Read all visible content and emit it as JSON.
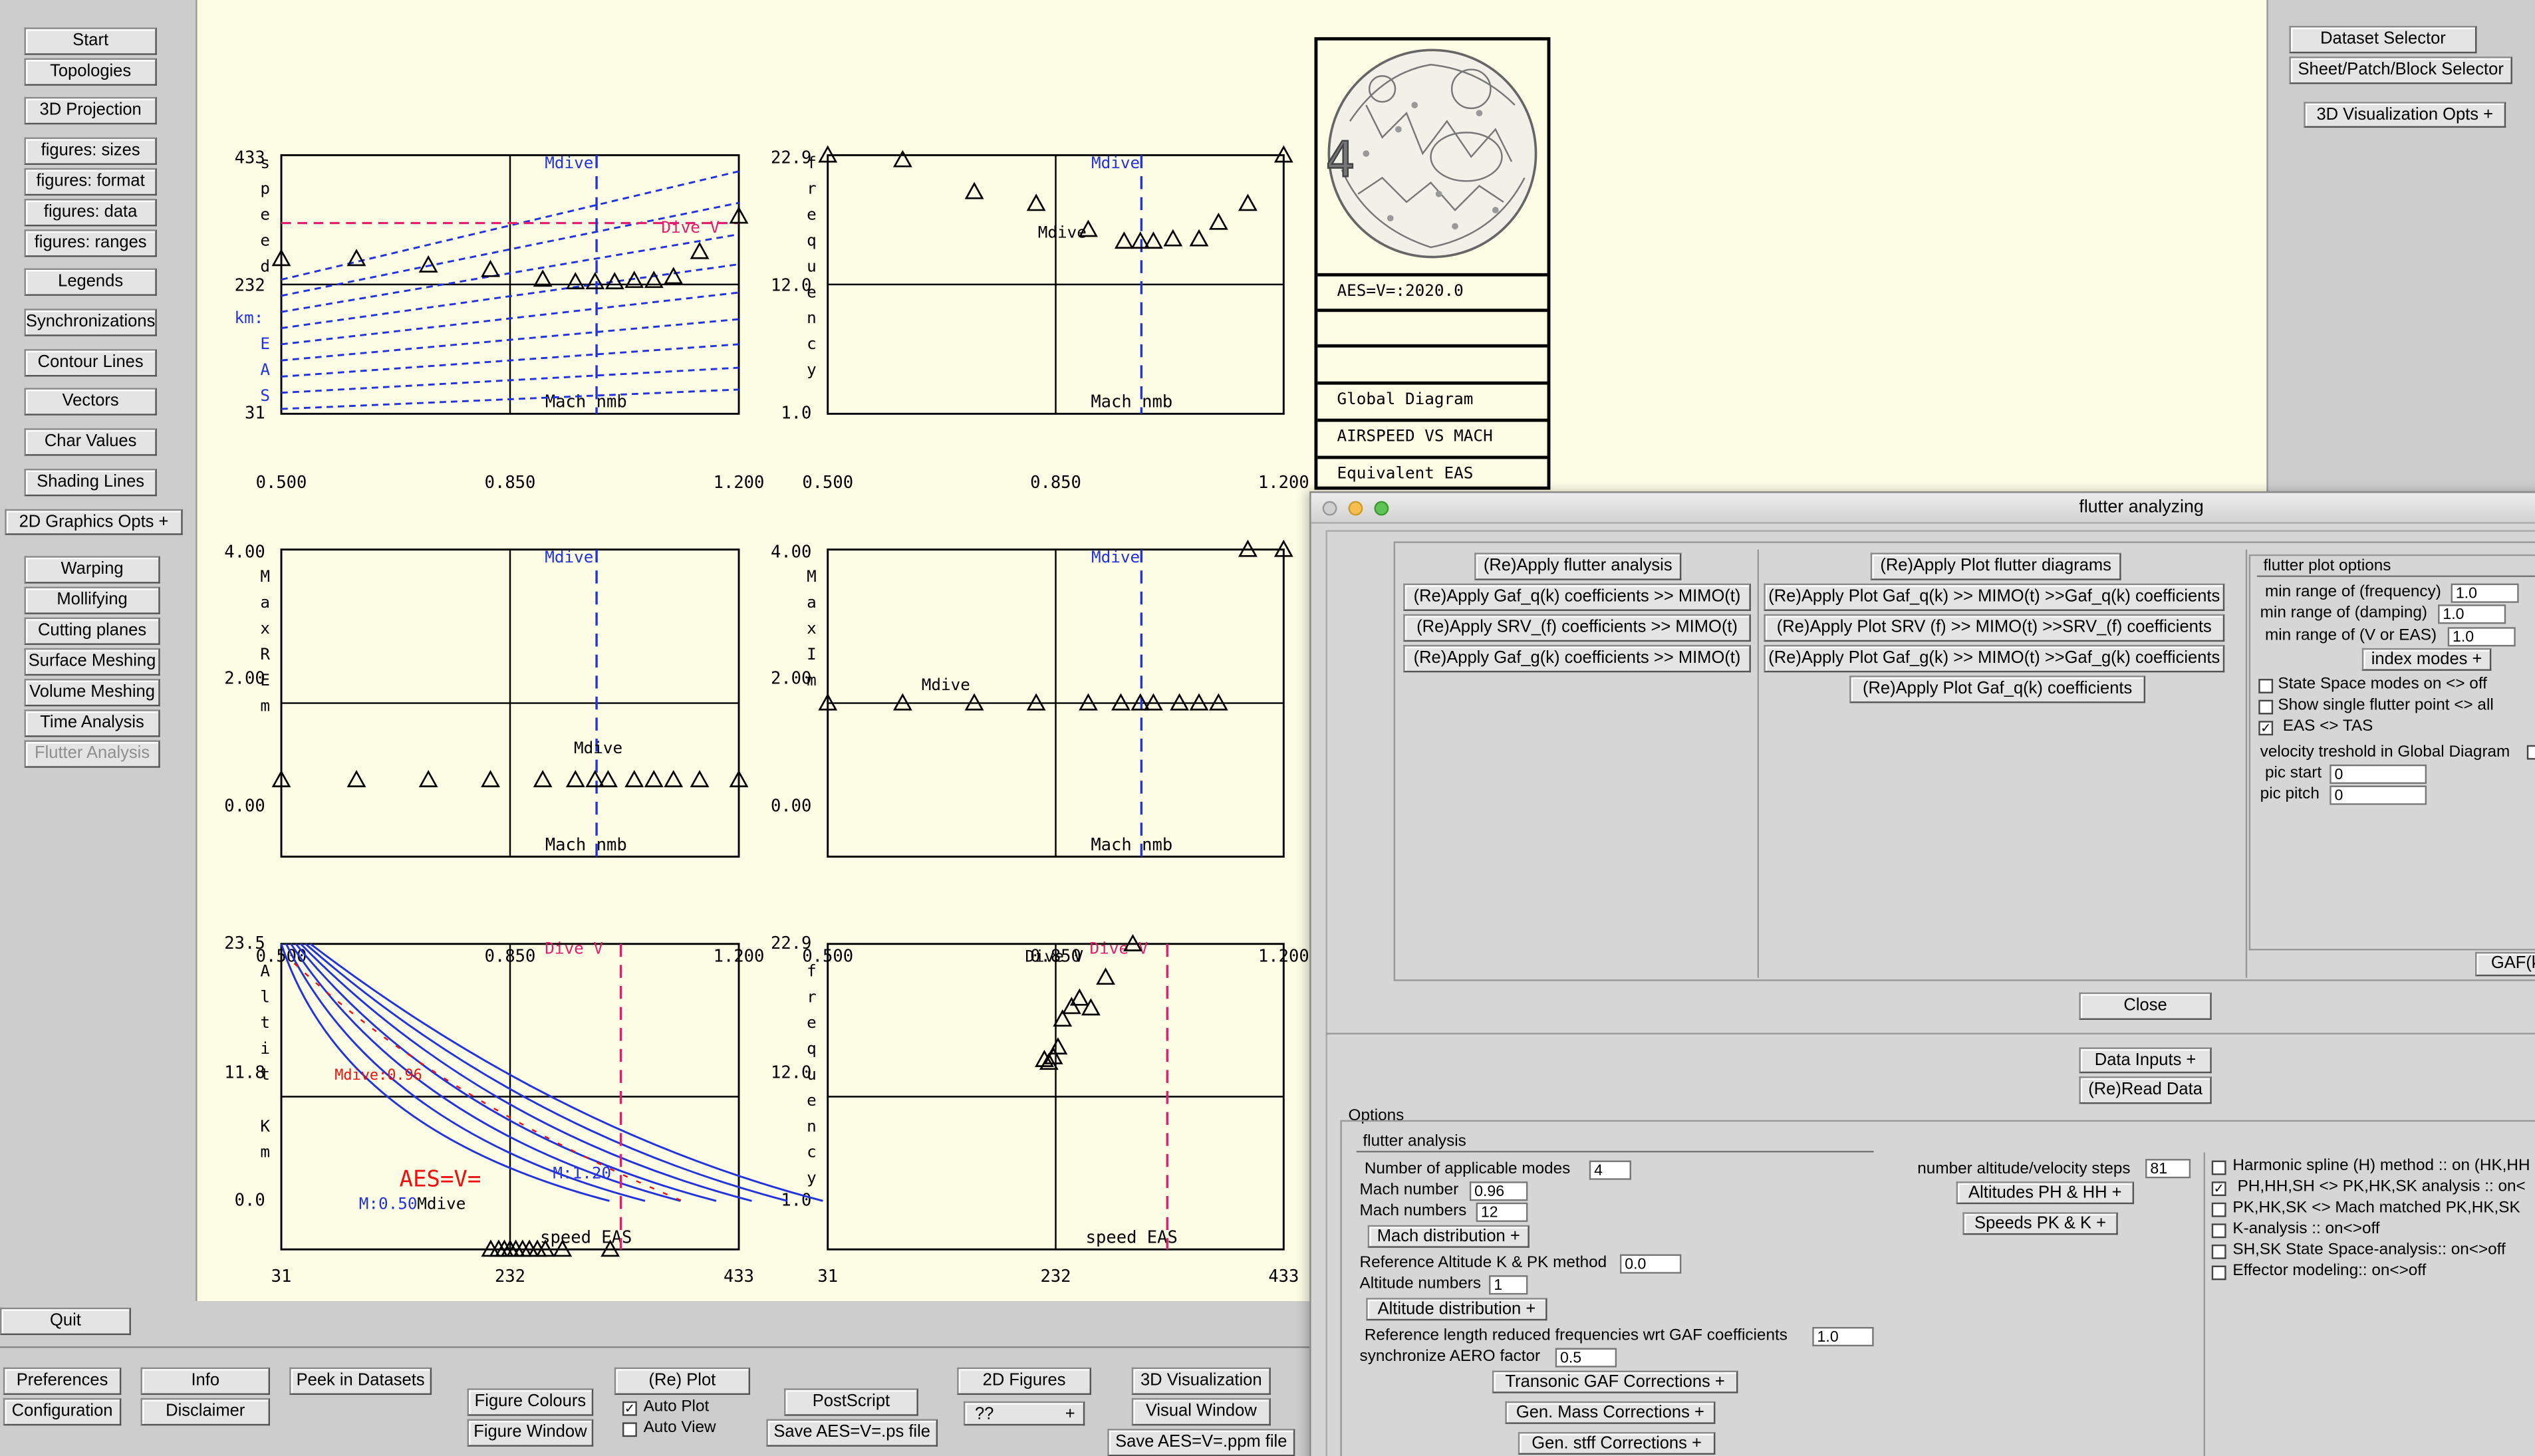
{
  "left_menu": [
    "Start",
    "Topologies",
    "3D Projection",
    "figures: sizes",
    "figures: format",
    "figures: data",
    "figures: ranges",
    "Legends",
    "Synchronizations",
    "Contour Lines",
    "Vectors",
    "Char Values",
    "Shading Lines"
  ],
  "graphics_opts": "2D Graphics Opts +",
  "left_menu2": [
    "Warping",
    "Mollifying",
    "Cutting planes",
    "Surface Meshing",
    "Volume  Meshing",
    "Time Analysis"
  ],
  "flutter_analysis_btn": "Flutter Analysis",
  "quit": "Quit",
  "bottom": {
    "preferences": "Preferences",
    "configuration": "Configuration",
    "info": "Info",
    "disclaimer": "Disclaimer",
    "peek": "Peek in Datasets",
    "figure_colours": "Figure Colours",
    "figure_window": "Figure Window",
    "replot": "(Re) Plot",
    "auto_plot": "Auto Plot",
    "auto_view": "Auto View",
    "postscript": "PostScript",
    "save_ps": "Save AES=V=.ps file",
    "figures_2d": "2D Figures",
    "qq": "??",
    "qq_plus": "+",
    "vis_3d": "3D Visualization",
    "visual_window": "Visual Window",
    "save_ppm": "Save AES=V=.ppm file"
  },
  "right_top": {
    "dataset_selector": "Dataset Selector",
    "sheet_selector": "Sheet/Patch/Block Selector",
    "vis_opts": "3D Visualization Opts +"
  },
  "info_box": {
    "aes": "AES=V=:2020.0",
    "lines": [
      "Global Diagram",
      "AIRSPEED  VS MACH",
      "Equivalent EAS"
    ]
  },
  "plots": {
    "p1": {
      "ylabels": [
        "433",
        "232",
        "31"
      ],
      "xlabels": [
        "0.500",
        "0.850",
        "1.200"
      ],
      "yletters": [
        "s",
        "p",
        "e",
        "e",
        "d",
        "",
        "km:",
        "E",
        "A",
        "S"
      ],
      "xtitle": "Mach nmb",
      "mdive": "Mdive",
      "divev": "Dive V",
      "mdive_inner": "Mdive"
    },
    "p2": {
      "ylabels": [
        "22.9",
        "12.0",
        "1.0"
      ],
      "xlabels": [
        "0.500",
        "0.850",
        "1.200"
      ],
      "yletters": [
        "f",
        "r",
        "e",
        "q",
        "u",
        "e",
        "n",
        "c",
        "y"
      ],
      "xtitle": "Mach nmb",
      "mdive": "Mdive",
      "mdive_inner": "Mdive"
    },
    "p3": {
      "ylabels": [
        "4.00",
        "2.00",
        "0.00"
      ],
      "xlabels": [
        "0.500",
        "0.850",
        "1.200"
      ],
      "yletters": [
        "M",
        "a",
        "x",
        "R",
        "E",
        "m"
      ],
      "xtitle": "Mach nmb",
      "mdive": "Mdive",
      "mdive_inner": "Mdive"
    },
    "p4": {
      "ylabels": [
        "4.00",
        "2.00",
        "0.00"
      ],
      "xlabels": [
        "0.500",
        "0.850",
        "1.200"
      ],
      "yletters": [
        "M",
        "a",
        "x",
        "I",
        "m"
      ],
      "xtitle": "Mach nmb",
      "mdive": "Mdive",
      "mdive_inner": "Mdive"
    },
    "p5": {
      "ylabels": [
        "23.5",
        "11.8",
        "0.0"
      ],
      "xlabels": [
        "31",
        "232",
        "433"
      ],
      "yletters": [
        "A",
        "l",
        "t",
        "i",
        "t",
        "",
        "K",
        "m"
      ],
      "xtitle": "speed EAS",
      "divev": "Dive V",
      "aes": "AES=V=",
      "m050": "M:0.50",
      "m120": "M:1.20",
      "mdive_inner": "Mdive",
      "mdive_m": "Mdive:0.96"
    },
    "p6": {
      "ylabels": [
        "22.9",
        "12.0",
        "1.0"
      ],
      "xlabels": [
        "31",
        "232",
        "433"
      ],
      "yletters": [
        "f",
        "r",
        "e",
        "q",
        "u",
        "e",
        "n",
        "c",
        "y"
      ],
      "xtitle": "speed EAS",
      "divev": "Dive V",
      "divev2": "Dive V"
    }
  },
  "chart_data": [
    {
      "type": "scatter",
      "title": "",
      "xlabel": "Mach nmb",
      "ylabel": "speed km: EAS",
      "xlim": [
        0.5,
        1.2
      ],
      "ylim": [
        31,
        433
      ],
      "series": [
        {
          "values": [
            [
              0.5,
              272
            ],
            [
              0.615,
              272
            ],
            [
              0.725,
              262
            ],
            [
              0.82,
              255
            ],
            [
              0.9,
              240
            ],
            [
              0.95,
              236
            ],
            [
              0.98,
              236
            ],
            [
              1.01,
              236
            ],
            [
              1.04,
              238
            ],
            [
              1.07,
              238
            ],
            [
              1.1,
              244
            ],
            [
              1.14,
              283
            ],
            [
              1.2,
              338
            ]
          ]
        }
      ]
    },
    {
      "type": "scatter",
      "title": "",
      "xlabel": "Mach nmb",
      "ylabel": "frequency",
      "xlim": [
        0.5,
        1.2
      ],
      "ylim": [
        1.0,
        22.9
      ],
      "series": [
        {
          "values": [
            [
              0.5,
              22.9
            ],
            [
              0.615,
              22.5
            ],
            [
              0.725,
              19.8
            ],
            [
              0.82,
              18.8
            ],
            [
              0.9,
              16.6
            ],
            [
              0.955,
              15.6
            ],
            [
              0.98,
              15.6
            ],
            [
              1.0,
              15.6
            ],
            [
              1.03,
              15.8
            ],
            [
              1.07,
              15.8
            ],
            [
              1.1,
              17.2
            ],
            [
              1.145,
              18.8
            ],
            [
              1.2,
              23.9
            ]
          ]
        }
      ]
    },
    {
      "type": "scatter",
      "title": "",
      "xlabel": "Mach nmb",
      "ylabel": "Max REm",
      "xlim": [
        0.5,
        1.2
      ],
      "ylim": [
        0,
        4
      ],
      "series": [
        {
          "values": [
            [
              0.5,
              1.0
            ],
            [
              0.615,
              1.0
            ],
            [
              0.725,
              1.0
            ],
            [
              0.82,
              1.0
            ],
            [
              0.9,
              1.0
            ],
            [
              0.95,
              1.0
            ],
            [
              0.98,
              1.0
            ],
            [
              1.0,
              1.0
            ],
            [
              1.04,
              1.0
            ],
            [
              1.07,
              1.0
            ],
            [
              1.1,
              1.0
            ],
            [
              1.14,
              1.0
            ],
            [
              1.2,
              1.0
            ]
          ]
        }
      ]
    },
    {
      "type": "scatter",
      "title": "",
      "xlabel": "Mach nmb",
      "ylabel": "Max Im",
      "xlim": [
        0.5,
        1.2
      ],
      "ylim": [
        0,
        4
      ],
      "series": [
        {
          "values": [
            [
              0.5,
              2.0
            ],
            [
              0.615,
              2.0
            ],
            [
              0.725,
              2.0
            ],
            [
              0.82,
              2.0
            ],
            [
              0.9,
              2.0
            ],
            [
              0.95,
              2.0
            ],
            [
              0.98,
              2.0
            ],
            [
              1.0,
              2.0
            ],
            [
              1.04,
              2.0
            ],
            [
              1.07,
              2.0
            ],
            [
              1.1,
              2.0
            ],
            [
              1.145,
              4.0
            ],
            [
              1.2,
              4.0
            ]
          ]
        }
      ]
    },
    {
      "type": "line",
      "title": "",
      "xlabel": "speed EAS",
      "ylabel": "Altit Km",
      "xlim": [
        31,
        433
      ],
      "ylim": [
        0,
        23.5
      ],
      "series": [
        {
          "values": [
            [
              215,
              0.0
            ],
            [
              222,
              0.0
            ],
            [
              227,
              0.0
            ],
            [
              232,
              0.0
            ],
            [
              237,
              0.0
            ],
            [
              243,
              0.0
            ],
            [
              249,
              0.0
            ],
            [
              256,
              0.0
            ],
            [
              263,
              0.0
            ],
            [
              278,
              0.0
            ],
            [
              320,
              0.0
            ]
          ]
        }
      ]
    },
    {
      "type": "scatter",
      "title": "",
      "xlabel": "speed EAS",
      "ylabel": "frequency",
      "xlim": [
        31,
        433
      ],
      "ylim": [
        1.0,
        22.9
      ],
      "series": [
        {
          "values": [
            [
              222,
              14.6
            ],
            [
              226,
              14.4
            ],
            [
              230,
              14.8
            ],
            [
              234,
              15.5
            ],
            [
              238,
              17.5
            ],
            [
              246,
              18.4
            ],
            [
              253,
              19.0
            ],
            [
              263,
              18.3
            ],
            [
              276,
              20.5
            ],
            [
              300,
              22.9
            ]
          ]
        }
      ]
    }
  ],
  "flutter_window": {
    "title": "flutter analyzing",
    "btn_apply_flutter": "(Re)Apply flutter analysis",
    "btn_apply_gaf_q": "(Re)Apply Gaf_q(k) coefficients >> MIMO(t)",
    "btn_apply_srv": "(Re)Apply SRV_(f) coefficients  >> MIMO(t)",
    "btn_apply_gaf_g": "(Re)Apply Gaf_g(k) coefficients >> MIMO(t)",
    "btn_plot_flutter": "(Re)Apply Plot flutter diagrams",
    "btn_plot_gaf_q": "(Re)Apply Plot Gaf_q(k) >> MIMO(t) >>Gaf_q(k) coefficients",
    "btn_plot_srv": "(Re)Apply Plot SRV  (f) >> MIMO(t) >>SRV_(f)  coefficients",
    "btn_plot_gaf_g": "(Re)Apply Plot Gaf_g(k) >> MIMO(t) >>Gaf_g(k) coefficients",
    "btn_plot_gaf_qk": "(Re)Apply Plot Gaf_q(k) coefficients",
    "plot_options": {
      "header": "flutter plot options",
      "min_freq": "min range of (frequency)",
      "min_freq_v": "1.0",
      "min_damp": "min range of (damping)",
      "min_damp_v": "1.0",
      "min_v": "min range of (V or EAS)",
      "min_v_v": "1.0",
      "index_modes": "index modes +",
      "state_space": "State Space modes on  <> off",
      "single_point": "Show single flutter point  <> all",
      "eas_tas": "EAS <> TAS",
      "vel_thresh": "velocity treshold in Global Diagram",
      "pic_start": "pic start",
      "pic_start_v": "0",
      "pic_pitch": "pic pitch",
      "pic_pitch_v": "0",
      "gaf": "GAF(k"
    },
    "close": "Close",
    "data_inputs": "Data Inputs +",
    "reread": "(Re)Read Data",
    "options": {
      "title": "Options",
      "section": "flutter analysis",
      "n_modes": "Number of applicable modes",
      "n_modes_v": "4",
      "mach_number": "Mach number",
      "mach_number_v": "0.96",
      "mach_numbers": "Mach numbers",
      "mach_numbers_v": "12",
      "mach_dist": "Mach distribution +",
      "ref_alt": "Reference Altitude K & PK method",
      "ref_alt_v": "0.0",
      "alt_numbers": "Altitude numbers",
      "alt_numbers_v": "1",
      "alt_dist": "Altitude distribution +",
      "ref_len": "Reference length reduced frequencies wrt GAF coefficients",
      "ref_len_v": "1.0",
      "sync_aero": "synchronize AERO factor",
      "sync_aero_v": "0.5",
      "transonic": "Transonic GAF Corrections +",
      "gen_mass": "Gen. Mass Corrections +",
      "gen_stiff": "Gen. stff Corrections +",
      "n_steps": "number altitude/velocity steps",
      "n_steps_v": "81",
      "alt_ph": "Altitudes PH & HH +",
      "speeds_pk": "Speeds PK & K +",
      "checks": [
        "Harmonic spline (H) method :: on (HK,HH",
        "PH,HH,SH <> PK,HK,SK analysis :: on<",
        "PK,HK,SK <> Mach matched PK,HK,SK",
        "K-analysis :: on<>off",
        "SH,SK State Space-analysis:: on<>off",
        "Effector modeling:: on<>off"
      ]
    }
  },
  "colors": {
    "plot_bg": "#fdfde6",
    "app_bg": "#cdcdcd",
    "blue": "#2233dd",
    "pink": "#e0206e",
    "red": "#ee1111"
  }
}
